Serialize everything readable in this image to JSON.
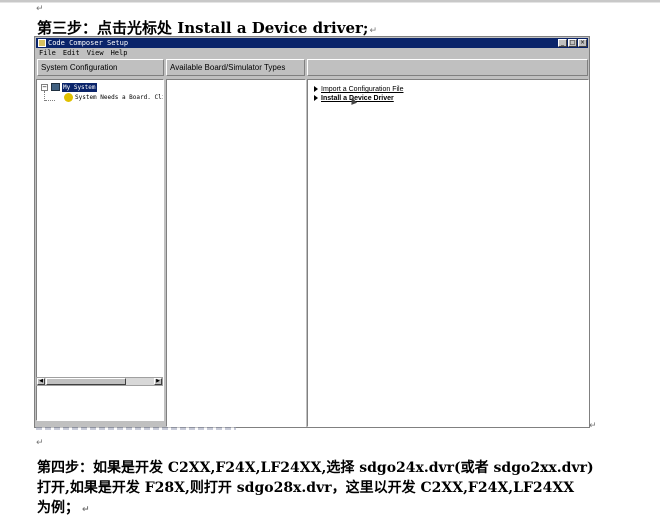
{
  "heading": "第三步：点击光标处 Install a Device driver;",
  "window": {
    "title": "Code Composer Setup",
    "menu": [
      "File",
      "Edit",
      "View",
      "Help"
    ],
    "columns": [
      "System Configuration",
      "Available Board/Simulator Types",
      ""
    ],
    "tree": {
      "root": "My System",
      "child": "System Needs a Board. Click"
    },
    "actions": [
      {
        "label": "Import a Configuration File",
        "bold": false
      },
      {
        "label": "Install a Device Driver",
        "bold": true
      }
    ]
  },
  "paragraph": {
    "line1": "第四步：如果是开发 C2XX,F24X,LF24XX,选择 sdgo24x.dvr(或者 sdgo2xx.dvr)",
    "line2": "打开,如果是开发 F28X,则打开 sdgo28x.dvr，这里以开发 C2XX,F24X,LF24XX",
    "line3": "为例；"
  },
  "marks": {
    "paragraph": "↵",
    "return": "↵"
  }
}
